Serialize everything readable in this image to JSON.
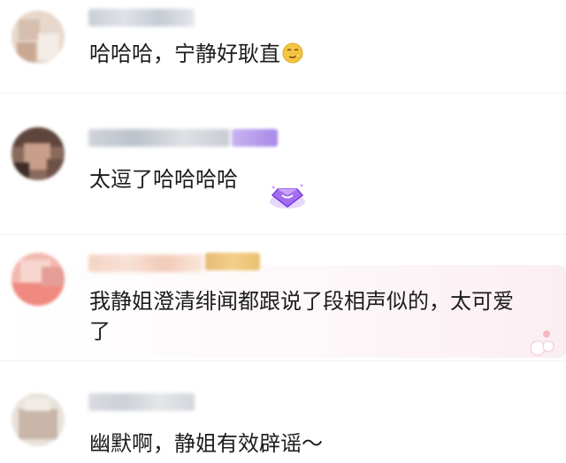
{
  "comments": [
    {
      "text": "哈哈哈，宁静好耿直",
      "emoji_icon": "smirk-face-icon"
    },
    {
      "text": "太逗了哈哈哈哈",
      "badge_icon": "purple-gem-badge-icon"
    },
    {
      "text": "我静姐澄清绯闻都跟说了段相声似的，太可爱了"
    },
    {
      "text": "幽默啊，静姐有效辟谣～"
    }
  ]
}
